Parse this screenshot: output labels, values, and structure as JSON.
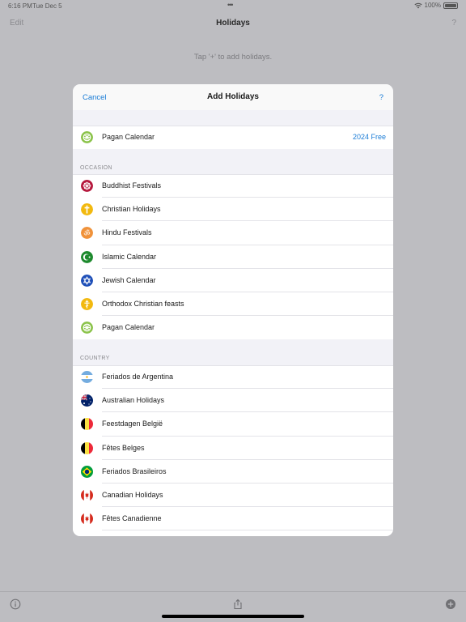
{
  "status_bar": {
    "time": "6:16 PM",
    "date": "Tue Dec 5",
    "battery": "100%"
  },
  "navbar": {
    "edit": "Edit",
    "title": "Holidays",
    "help": "?"
  },
  "hint": "Tap '+' to add holidays.",
  "sheet": {
    "cancel": "Cancel",
    "title": "Add Holidays",
    "help": "?",
    "featured": {
      "label": "Pagan Calendar",
      "detail": "2024 Free",
      "icon": "pagan-wheel-icon"
    },
    "occasion_header": "OCCASION",
    "occasions": [
      {
        "label": "Buddhist Festivals",
        "icon": "dharma-wheel-icon"
      },
      {
        "label": "Christian Holidays",
        "icon": "cross-icon"
      },
      {
        "label": "Hindu Festivals",
        "icon": "om-icon"
      },
      {
        "label": "Islamic Calendar",
        "icon": "crescent-star-icon"
      },
      {
        "label": "Jewish Calendar",
        "icon": "star-of-david-icon"
      },
      {
        "label": "Orthodox Christian feasts",
        "icon": "orthodox-cross-icon"
      },
      {
        "label": "Pagan Calendar",
        "icon": "pagan-wheel-icon"
      }
    ],
    "country_header": "COUNTRY",
    "countries": [
      {
        "label": "Feriados de Argentina",
        "icon": "argentina-flag-icon"
      },
      {
        "label": "Australian Holidays",
        "icon": "australia-flag-icon"
      },
      {
        "label": "Feestdagen België",
        "icon": "belgium-flag-icon"
      },
      {
        "label": "Fêtes Belges",
        "icon": "belgium-flag-icon"
      },
      {
        "label": "Feriados Brasileiros",
        "icon": "brazil-flag-icon"
      },
      {
        "label": "Canadian Holidays",
        "icon": "canada-flag-icon"
      },
      {
        "label": "Fêtes Canadienne",
        "icon": "canada-flag-icon"
      }
    ]
  },
  "colors": {
    "accent": "#1a7cd6",
    "backdrop": "#bdbdc1"
  }
}
